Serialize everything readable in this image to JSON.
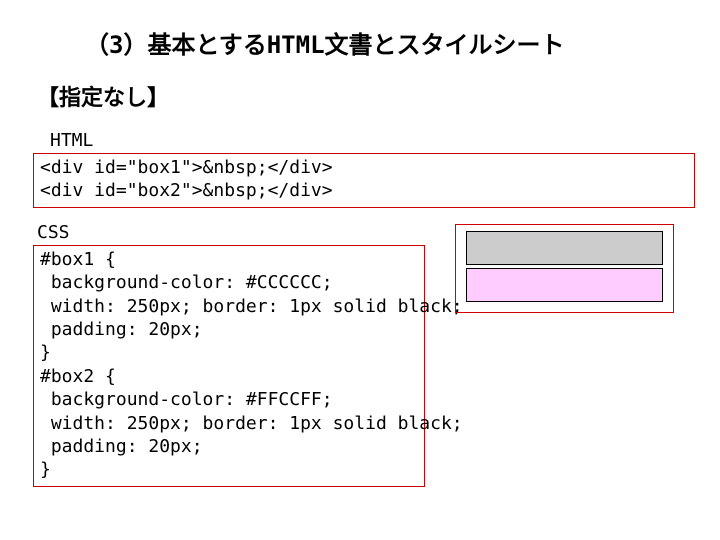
{
  "title": "（3）基本とするHTML文書とスタイルシート",
  "subtitle": "【指定なし】",
  "html_label": "HTML",
  "html_code": "<div id=\"box1\">&nbsp;</div>\n<div id=\"box2\">&nbsp;</div>",
  "css_label": "CSS",
  "css_code": "#box1 {\n background-color: #CCCCCC;\n width: 250px; border: 1px solid black;\n padding: 20px;\n}\n#box2 {\n background-color: #FFCCFF;\n width: 250px; border: 1px solid black;\n padding: 20px;\n}",
  "preview": {
    "box1_color": "#CCCCCC",
    "box2_color": "#FFCCFF"
  }
}
